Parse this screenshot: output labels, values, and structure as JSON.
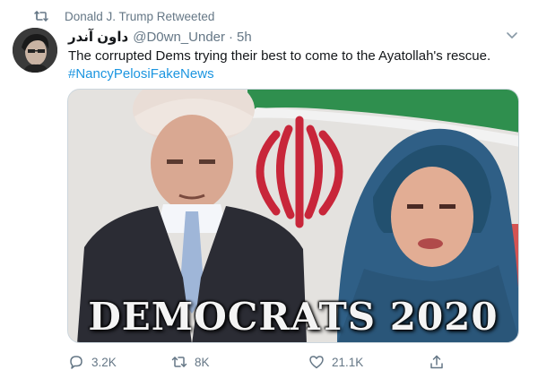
{
  "retweet_banner": {
    "text": "Donald J. Trump Retweeted",
    "icon": "retweet-icon"
  },
  "tweet": {
    "display_name": "داون آندر",
    "handle": "@D0wn_Under",
    "separator": "·",
    "time": "5h",
    "text": "The corrupted Dems trying their best to come to the Ayatollah's rescue.",
    "hashtag": "#NancyPelosiFakeNews",
    "media_caption": "DEMOCRATS 2020"
  },
  "actions": {
    "reply_count": "3.2K",
    "retweet_count": "8K",
    "like_count": "21.1K"
  },
  "colors": {
    "link": "#1b95e0",
    "muted": "#657786",
    "text": "#14171a"
  }
}
